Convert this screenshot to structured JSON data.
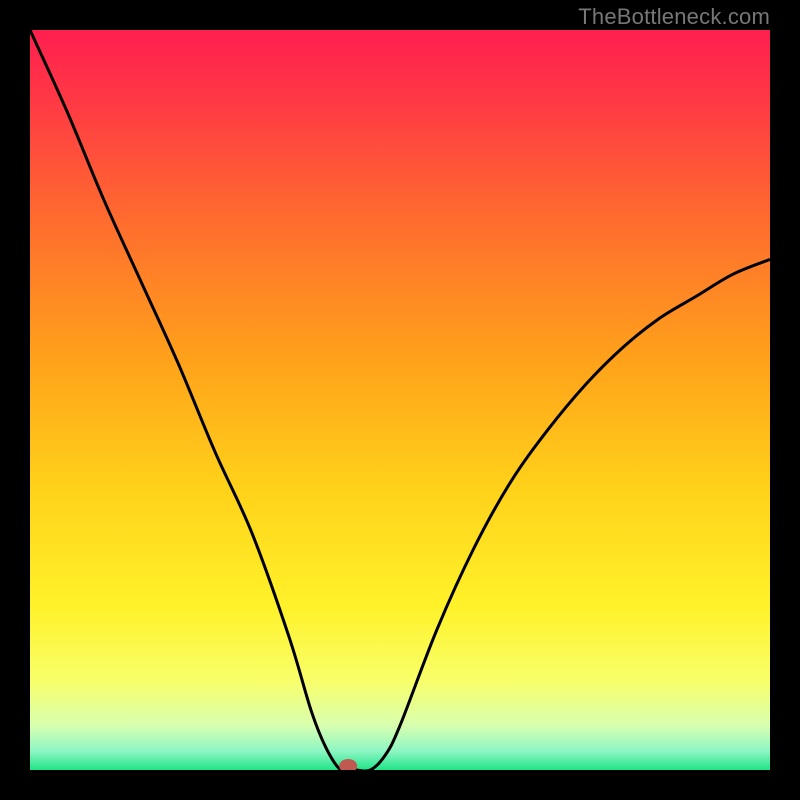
{
  "watermark": "TheBottleneck.com",
  "chart_data": {
    "type": "line",
    "title": "",
    "xlabel": "",
    "ylabel": "",
    "xlim": [
      0,
      100
    ],
    "ylim": [
      0,
      100
    ],
    "curve": {
      "name": "bottleneck-curve",
      "x": [
        0,
        5,
        10,
        15,
        20,
        25,
        30,
        35,
        38,
        40,
        42,
        44,
        46,
        48,
        50,
        55,
        60,
        65,
        70,
        75,
        80,
        85,
        90,
        95,
        100
      ],
      "y": [
        100,
        89,
        77,
        66,
        55,
        43,
        32,
        18,
        8,
        3,
        0,
        0,
        0,
        2,
        6,
        19,
        30,
        39,
        46,
        52,
        57,
        61,
        64,
        67,
        69
      ]
    },
    "marker": {
      "x": 43,
      "y": 0
    },
    "gradient_stops": [
      {
        "offset": 0.0,
        "color": "#ff1f4f"
      },
      {
        "offset": 0.1,
        "color": "#ff3a44"
      },
      {
        "offset": 0.25,
        "color": "#ff6a2f"
      },
      {
        "offset": 0.45,
        "color": "#ffa31a"
      },
      {
        "offset": 0.62,
        "color": "#ffd21a"
      },
      {
        "offset": 0.78,
        "color": "#fff22a"
      },
      {
        "offset": 0.88,
        "color": "#f8ff6a"
      },
      {
        "offset": 0.94,
        "color": "#d8ffb0"
      },
      {
        "offset": 0.975,
        "color": "#8cf6c3"
      },
      {
        "offset": 1.0,
        "color": "#1fe487"
      }
    ],
    "marker_color": "#c05a50",
    "curve_color": "#000000"
  }
}
